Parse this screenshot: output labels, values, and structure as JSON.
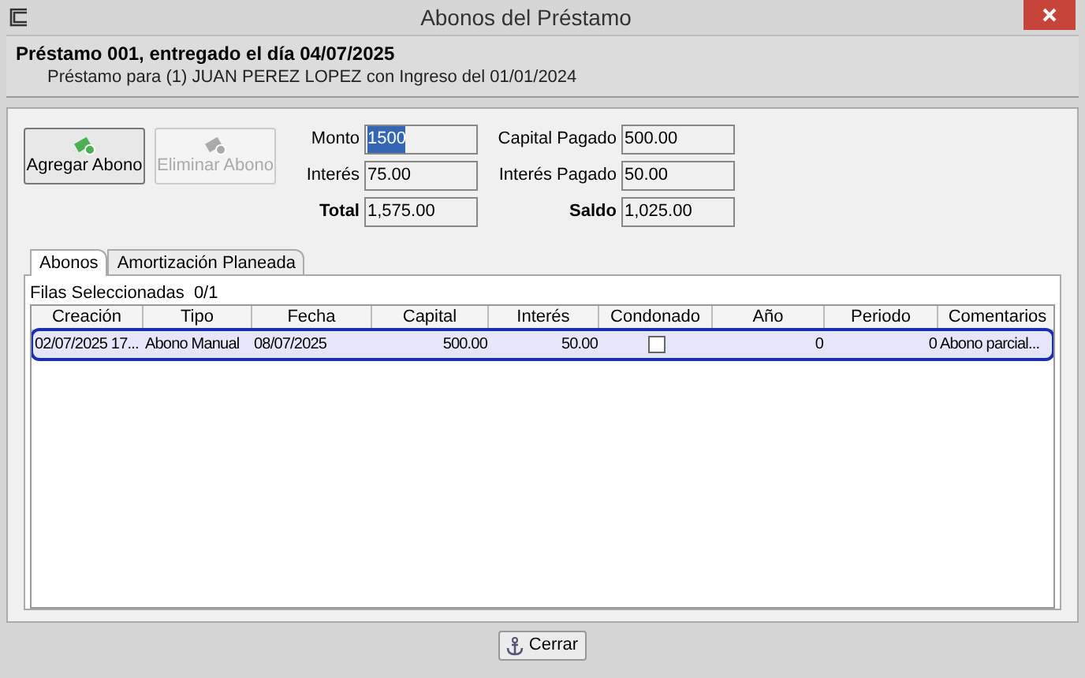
{
  "window": {
    "title": "Abonos del Préstamo"
  },
  "header": {
    "title": "Préstamo 001, entregado el día 04/07/2025",
    "subtitle": "Préstamo para (1) JUAN PEREZ LOPEZ con Ingreso del 01/01/2024"
  },
  "buttons": [
    {
      "label": "Agregar Abono",
      "disabled": false
    },
    {
      "label": "Eliminar Abono",
      "disabled": true
    }
  ],
  "fields": [
    {
      "label": "Monto",
      "value": "1500",
      "bold": false,
      "selected": true
    },
    {
      "label": "Interés",
      "value": "75.00",
      "bold": false,
      "selected": false
    },
    {
      "label": "Total",
      "value": "1,575.00",
      "bold": true,
      "selected": false
    }
  ],
  "fields_right": [
    {
      "label": "Capital Pagado",
      "value": "500.00",
      "bold": false,
      "selected": false
    },
    {
      "label": "Interés Pagado",
      "value": "50.00",
      "bold": false,
      "selected": false
    },
    {
      "label": "Saldo",
      "value": "1,025.00",
      "bold": true,
      "selected": false
    }
  ],
  "tabs": [
    {
      "label": "Abonos",
      "selected": true
    },
    {
      "label": "Amortización Planeada",
      "selected": false
    }
  ],
  "table": {
    "caption": "Filas Seleccionadas  0/1",
    "columns": [
      "Creación",
      "Tipo",
      "Fecha",
      "Capital",
      "Interés",
      "Condonado",
      "Año",
      "Periodo",
      "Comentarios"
    ],
    "rows": [
      {
        "selected": true,
        "condonado": false,
        "cells": [
          "02/07/2025 17...",
          "Abono Manual",
          "08/07/2025",
          "500.00",
          "50.00",
          "",
          "0",
          "0",
          "Abono parcial..."
        ]
      }
    ]
  },
  "close_button": {
    "label": "Cerrar"
  }
}
